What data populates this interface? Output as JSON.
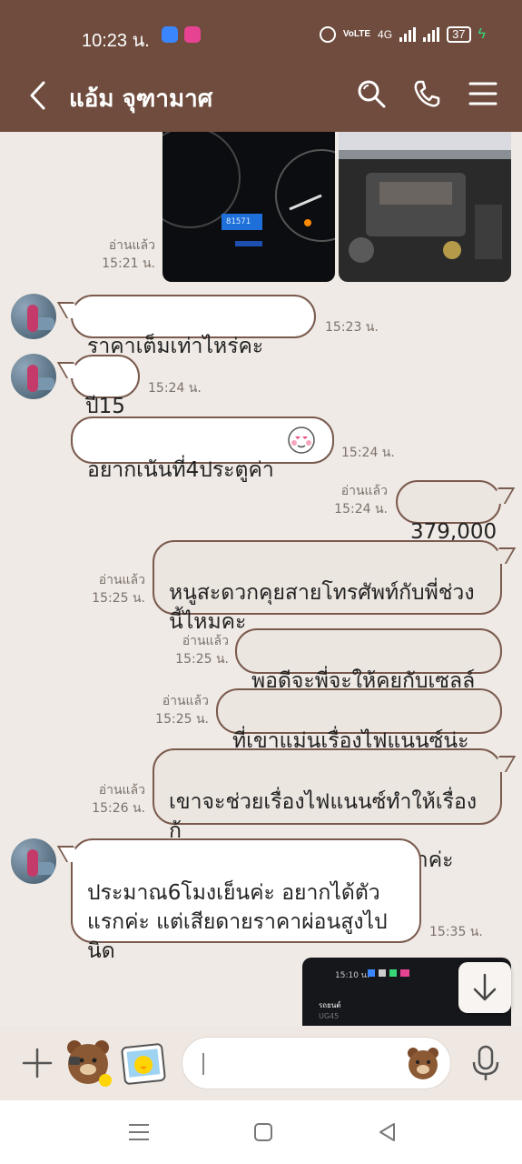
{
  "status_bar": {
    "time": "10:23 น.",
    "battery": "37",
    "network": "4G",
    "volte": "VoLTE"
  },
  "header": {
    "title": "แอ้ม จุฑามาศ"
  },
  "messages": [
    {
      "kind": "photo_meta",
      "read": "อ่านแล้ว",
      "time": "15:21 น."
    },
    {
      "kind": "incoming",
      "text": "ราคาเต็มเท่าไหร่คะฟอด",
      "time": "15:23 น."
    },
    {
      "kind": "incoming",
      "text": "ปี15",
      "time": "15:24 น."
    },
    {
      "kind": "incoming",
      "text": "อยากเน้นที่4ประตูค่า",
      "time": "15:24 น."
    },
    {
      "kind": "outgoing",
      "text": "379,000",
      "read": "อ่านแล้ว",
      "time": "15:24 น."
    },
    {
      "kind": "outgoing",
      "text": "หนูสะดวกคุยสายโทรศัพท์กับพี่ช่วง\nนี้ไหมคะ",
      "read": "อ่านแล้ว",
      "time": "15:25 น."
    },
    {
      "kind": "outgoing",
      "text": "พอดีจะพี่จะให้คุยกับเซลล์",
      "read": "อ่านแล้ว",
      "time": "15:25 น."
    },
    {
      "kind": "outgoing",
      "text": "ที่เขาแม่นเรื่องไฟแนนซ์น่ะค่ะ",
      "read": "อ่านแล้ว",
      "time": "15:25 น."
    },
    {
      "kind": "outgoing",
      "text": "เขาจะช่วยเรื่องไฟแนนซ์ทำให้เรื่องกู้\nได้ยอดจำนวนเต็มได้มากกว่าค่ะ",
      "read": "อ่านแล้ว",
      "time": "15:26 น."
    },
    {
      "kind": "incoming",
      "text": "ประมาณ6โมงเย็นค่ะ อยากได้ตัว\nแรกค่ะ แต่เสียดายราคาผ่อนสูงไป\nนิด",
      "time": "15:35 น."
    }
  ],
  "photos": {
    "dashboard_reading": "81571",
    "preview_time": "15:10 น.",
    "preview_line1": "รถยนต์",
    "preview_line2": "UG45"
  },
  "icons": {
    "back": "chevron-left-icon",
    "search": "search-icon",
    "call": "phone-icon",
    "menu": "menu-icon",
    "plus": "plus-icon",
    "mic": "microphone-icon",
    "scroll": "arrow-down-icon"
  },
  "colors": {
    "header_bg": "#6f4c3e",
    "bubble_border": "#7a5a4e",
    "chat_bg": "#efeae5"
  }
}
